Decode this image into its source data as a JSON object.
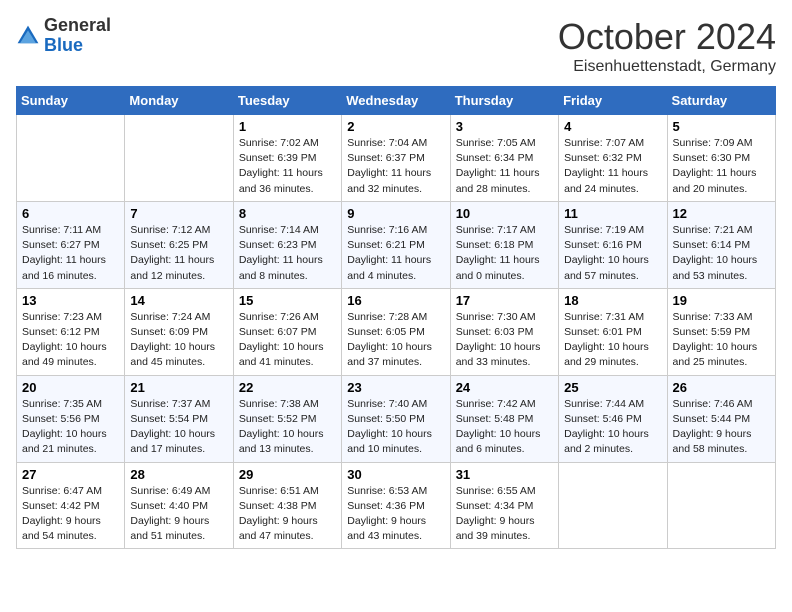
{
  "logo": {
    "general": "General",
    "blue": "Blue"
  },
  "header": {
    "month": "October 2024",
    "location": "Eisenhuettenstadt, Germany"
  },
  "days_of_week": [
    "Sunday",
    "Monday",
    "Tuesday",
    "Wednesday",
    "Thursday",
    "Friday",
    "Saturday"
  ],
  "weeks": [
    [
      {
        "num": "",
        "detail": ""
      },
      {
        "num": "",
        "detail": ""
      },
      {
        "num": "1",
        "detail": "Sunrise: 7:02 AM\nSunset: 6:39 PM\nDaylight: 11 hours and 36 minutes."
      },
      {
        "num": "2",
        "detail": "Sunrise: 7:04 AM\nSunset: 6:37 PM\nDaylight: 11 hours and 32 minutes."
      },
      {
        "num": "3",
        "detail": "Sunrise: 7:05 AM\nSunset: 6:34 PM\nDaylight: 11 hours and 28 minutes."
      },
      {
        "num": "4",
        "detail": "Sunrise: 7:07 AM\nSunset: 6:32 PM\nDaylight: 11 hours and 24 minutes."
      },
      {
        "num": "5",
        "detail": "Sunrise: 7:09 AM\nSunset: 6:30 PM\nDaylight: 11 hours and 20 minutes."
      }
    ],
    [
      {
        "num": "6",
        "detail": "Sunrise: 7:11 AM\nSunset: 6:27 PM\nDaylight: 11 hours and 16 minutes."
      },
      {
        "num": "7",
        "detail": "Sunrise: 7:12 AM\nSunset: 6:25 PM\nDaylight: 11 hours and 12 minutes."
      },
      {
        "num": "8",
        "detail": "Sunrise: 7:14 AM\nSunset: 6:23 PM\nDaylight: 11 hours and 8 minutes."
      },
      {
        "num": "9",
        "detail": "Sunrise: 7:16 AM\nSunset: 6:21 PM\nDaylight: 11 hours and 4 minutes."
      },
      {
        "num": "10",
        "detail": "Sunrise: 7:17 AM\nSunset: 6:18 PM\nDaylight: 11 hours and 0 minutes."
      },
      {
        "num": "11",
        "detail": "Sunrise: 7:19 AM\nSunset: 6:16 PM\nDaylight: 10 hours and 57 minutes."
      },
      {
        "num": "12",
        "detail": "Sunrise: 7:21 AM\nSunset: 6:14 PM\nDaylight: 10 hours and 53 minutes."
      }
    ],
    [
      {
        "num": "13",
        "detail": "Sunrise: 7:23 AM\nSunset: 6:12 PM\nDaylight: 10 hours and 49 minutes."
      },
      {
        "num": "14",
        "detail": "Sunrise: 7:24 AM\nSunset: 6:09 PM\nDaylight: 10 hours and 45 minutes."
      },
      {
        "num": "15",
        "detail": "Sunrise: 7:26 AM\nSunset: 6:07 PM\nDaylight: 10 hours and 41 minutes."
      },
      {
        "num": "16",
        "detail": "Sunrise: 7:28 AM\nSunset: 6:05 PM\nDaylight: 10 hours and 37 minutes."
      },
      {
        "num": "17",
        "detail": "Sunrise: 7:30 AM\nSunset: 6:03 PM\nDaylight: 10 hours and 33 minutes."
      },
      {
        "num": "18",
        "detail": "Sunrise: 7:31 AM\nSunset: 6:01 PM\nDaylight: 10 hours and 29 minutes."
      },
      {
        "num": "19",
        "detail": "Sunrise: 7:33 AM\nSunset: 5:59 PM\nDaylight: 10 hours and 25 minutes."
      }
    ],
    [
      {
        "num": "20",
        "detail": "Sunrise: 7:35 AM\nSunset: 5:56 PM\nDaylight: 10 hours and 21 minutes."
      },
      {
        "num": "21",
        "detail": "Sunrise: 7:37 AM\nSunset: 5:54 PM\nDaylight: 10 hours and 17 minutes."
      },
      {
        "num": "22",
        "detail": "Sunrise: 7:38 AM\nSunset: 5:52 PM\nDaylight: 10 hours and 13 minutes."
      },
      {
        "num": "23",
        "detail": "Sunrise: 7:40 AM\nSunset: 5:50 PM\nDaylight: 10 hours and 10 minutes."
      },
      {
        "num": "24",
        "detail": "Sunrise: 7:42 AM\nSunset: 5:48 PM\nDaylight: 10 hours and 6 minutes."
      },
      {
        "num": "25",
        "detail": "Sunrise: 7:44 AM\nSunset: 5:46 PM\nDaylight: 10 hours and 2 minutes."
      },
      {
        "num": "26",
        "detail": "Sunrise: 7:46 AM\nSunset: 5:44 PM\nDaylight: 9 hours and 58 minutes."
      }
    ],
    [
      {
        "num": "27",
        "detail": "Sunrise: 6:47 AM\nSunset: 4:42 PM\nDaylight: 9 hours and 54 minutes."
      },
      {
        "num": "28",
        "detail": "Sunrise: 6:49 AM\nSunset: 4:40 PM\nDaylight: 9 hours and 51 minutes."
      },
      {
        "num": "29",
        "detail": "Sunrise: 6:51 AM\nSunset: 4:38 PM\nDaylight: 9 hours and 47 minutes."
      },
      {
        "num": "30",
        "detail": "Sunrise: 6:53 AM\nSunset: 4:36 PM\nDaylight: 9 hours and 43 minutes."
      },
      {
        "num": "31",
        "detail": "Sunrise: 6:55 AM\nSunset: 4:34 PM\nDaylight: 9 hours and 39 minutes."
      },
      {
        "num": "",
        "detail": ""
      },
      {
        "num": "",
        "detail": ""
      }
    ]
  ]
}
